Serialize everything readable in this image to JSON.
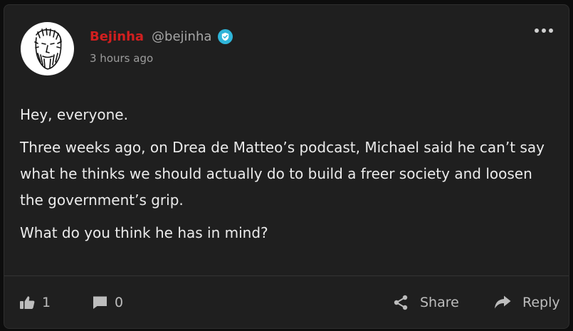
{
  "post": {
    "author_name": "Bejinha",
    "author_handle": "@bejinha",
    "timestamp": "3 hours ago",
    "paragraphs": [
      "Hey, everyone.",
      "Three weeks ago, on Drea de Matteo’s podcast, Michael said he can’t say what he thinks we should actually do to build a freer society and loosen the government’s grip.",
      "What do you think he has in mind?"
    ]
  },
  "actions": {
    "like_count": "1",
    "comment_count": "0",
    "share_label": "Share",
    "reply_label": "Reply"
  },
  "icons": {
    "avatar": "sketch-face-avatar",
    "badge": "verified-badge-icon",
    "menu": "more-options-icon",
    "like": "thumbs-up-icon",
    "comment": "comment-bubble-icon",
    "share": "share-icon",
    "reply": "reply-arrow-icon"
  },
  "colors": {
    "author_name": "#d11f1f",
    "card_background": "#1f1f1f",
    "badge": "#2fb5d9"
  }
}
